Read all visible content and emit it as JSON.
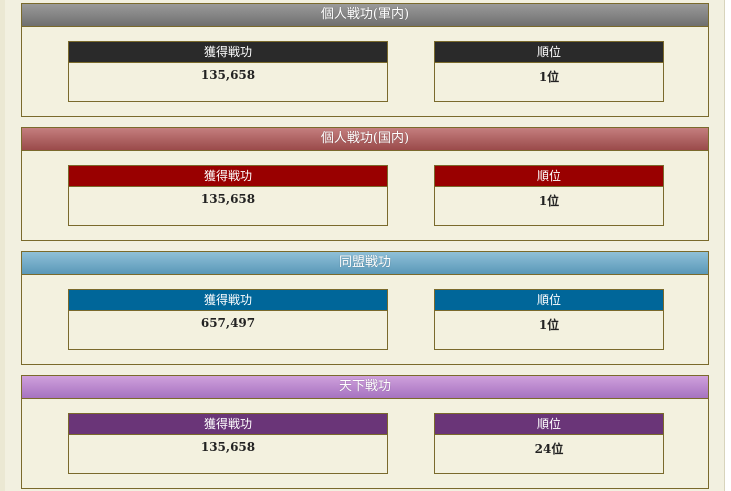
{
  "sections": [
    {
      "title": "個人戦功(軍内)",
      "header_gradient": [
        "#9a9a9a",
        "#6f6f6f"
      ],
      "box_head_color": "#2a2a2a",
      "points_label": "獲得戦功",
      "points_value": "135,658",
      "rank_label": "順位",
      "rank_value": "1位"
    },
    {
      "title": "個人戦功(国内)",
      "header_gradient": [
        "#c47e7e",
        "#9a4a4a"
      ],
      "box_head_color": "#990000",
      "points_label": "獲得戦功",
      "points_value": "135,658",
      "rank_label": "順位",
      "rank_value": "1位"
    },
    {
      "title": "同盟戦功",
      "header_gradient": [
        "#8fc0d8",
        "#5a98b8"
      ],
      "box_head_color": "#006699",
      "points_label": "獲得戦功",
      "points_value": "657,497",
      "rank_label": "順位",
      "rank_value": "1位"
    },
    {
      "title": "天下戦功",
      "header_gradient": [
        "#cfa0dc",
        "#a673c0"
      ],
      "box_head_color": "#6a3578",
      "points_label": "獲得戦功",
      "points_value": "135,658",
      "rank_label": "順位",
      "rank_value": "24位"
    }
  ]
}
